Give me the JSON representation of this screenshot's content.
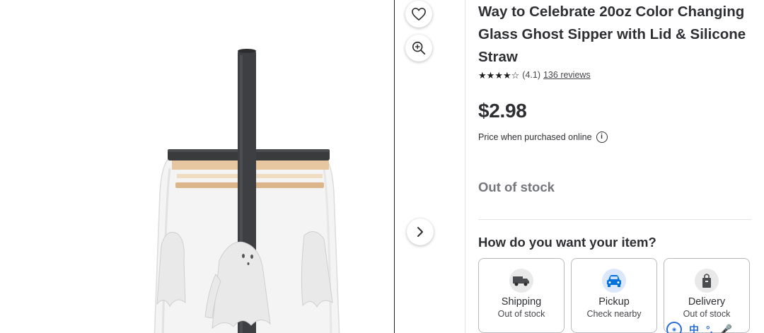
{
  "product": {
    "title": "Way to Celebrate 20oz Color Changing Glass Ghost Sipper with Lid & Silicone Straw",
    "rating_value": "(4.1)",
    "rating_stars": 4.1,
    "reviews_label": "136 reviews",
    "price": "$2.98",
    "price_note": "Price when purchased online",
    "stock_status": "Out of stock"
  },
  "fulfillment": {
    "heading": "How do you want your item?",
    "options": [
      {
        "label": "Shipping",
        "sub": "Out of stock",
        "icon": "truck-icon"
      },
      {
        "label": "Pickup",
        "sub": "Check nearby",
        "icon": "car-icon"
      },
      {
        "label": "Delivery",
        "sub": "Out of stock",
        "icon": "bag-icon"
      }
    ]
  },
  "icons": {
    "favorite": "heart-icon",
    "zoom": "zoom-in-icon",
    "next": "chevron-right-icon",
    "info": "info-icon"
  },
  "ime_toolbar": {
    "items": [
      "中",
      "°,",
      "🎤"
    ]
  },
  "colors": {
    "text": "#2e2f32",
    "muted": "#74767c",
    "pickup_accent": "#0071dc",
    "ime_blue": "#2a6dd8"
  }
}
